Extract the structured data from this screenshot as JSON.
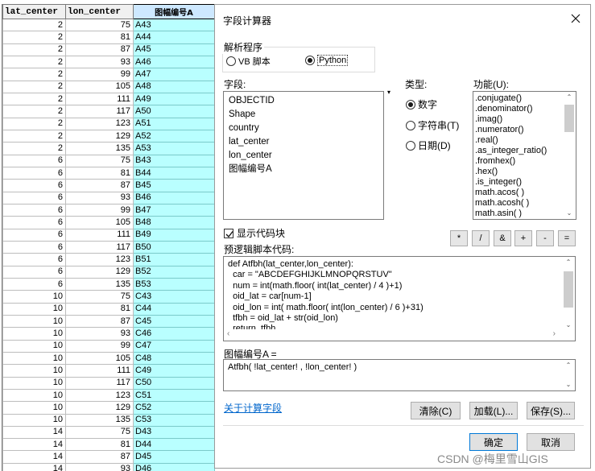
{
  "attribute_table": {
    "columns": [
      "lat_center",
      "lon_center",
      "图幅编号A"
    ],
    "rows": [
      [
        "2",
        "75",
        "A43"
      ],
      [
        "2",
        "81",
        "A44"
      ],
      [
        "2",
        "87",
        "A45"
      ],
      [
        "2",
        "93",
        "A46"
      ],
      [
        "2",
        "99",
        "A47"
      ],
      [
        "2",
        "105",
        "A48"
      ],
      [
        "2",
        "111",
        "A49"
      ],
      [
        "2",
        "117",
        "A50"
      ],
      [
        "2",
        "123",
        "A51"
      ],
      [
        "2",
        "129",
        "A52"
      ],
      [
        "2",
        "135",
        "A53"
      ],
      [
        "6",
        "75",
        "B43"
      ],
      [
        "6",
        "81",
        "B44"
      ],
      [
        "6",
        "87",
        "B45"
      ],
      [
        "6",
        "93",
        "B46"
      ],
      [
        "6",
        "99",
        "B47"
      ],
      [
        "6",
        "105",
        "B48"
      ],
      [
        "6",
        "111",
        "B49"
      ],
      [
        "6",
        "117",
        "B50"
      ],
      [
        "6",
        "123",
        "B51"
      ],
      [
        "6",
        "129",
        "B52"
      ],
      [
        "6",
        "135",
        "B53"
      ],
      [
        "10",
        "75",
        "C43"
      ],
      [
        "10",
        "81",
        "C44"
      ],
      [
        "10",
        "87",
        "C45"
      ],
      [
        "10",
        "93",
        "C46"
      ],
      [
        "10",
        "99",
        "C47"
      ],
      [
        "10",
        "105",
        "C48"
      ],
      [
        "10",
        "111",
        "C49"
      ],
      [
        "10",
        "117",
        "C50"
      ],
      [
        "10",
        "123",
        "C51"
      ],
      [
        "10",
        "129",
        "C52"
      ],
      [
        "10",
        "135",
        "C53"
      ],
      [
        "14",
        "75",
        "D43"
      ],
      [
        "14",
        "81",
        "D44"
      ],
      [
        "14",
        "87",
        "D45"
      ],
      [
        "14",
        "93",
        "D46"
      ]
    ]
  },
  "dialog": {
    "title": "字段计算器",
    "parser": {
      "legend": "解析程序",
      "options": [
        "VB 脚本",
        "Python"
      ],
      "selected": "Python"
    },
    "fields": {
      "label": "字段:",
      "items": [
        "OBJECTID",
        "Shape",
        "country",
        "lat_center",
        "lon_center",
        "图幅编号A"
      ]
    },
    "type": {
      "label": "类型:",
      "options": [
        "数字",
        "字符串(T)",
        "日期(D)"
      ],
      "selected": "数字"
    },
    "functions": {
      "label": "功能(U):",
      "items": [
        ".conjugate()",
        ".denominator()",
        ".imag()",
        ".numerator()",
        ".real()",
        ".as_integer_ratio()",
        ".fromhex()",
        ".hex()",
        ".is_integer()",
        "math.acos( )",
        "math.acosh( )",
        "math.asin( )"
      ]
    },
    "operators": [
      "*",
      "/",
      "&",
      "+",
      "-",
      "="
    ],
    "show_codeblock": {
      "label": "显示代码块",
      "checked": true
    },
    "codeblock": {
      "label": "预逻辑脚本代码:",
      "lines": [
        "def Atfbh(lat_center,lon_center):",
        "  car = \"ABCDEFGHIJKLMNOPQRSTUV\"",
        "  num = int(math.floor( int(lat_center) / 4 )+1)",
        "  oid_lat = car[num-1]",
        "  oid_lon = int( math.floor( int(lon_center) / 6 )+31)",
        "  tfbh = oid_lat + str(oid_lon)",
        "  return  tfbh"
      ]
    },
    "expression": {
      "label": "图幅编号A =",
      "value": "Atfbh( !lat_center! , !lon_center! )"
    },
    "about_link": "关于计算字段",
    "buttons": {
      "clear": "清除(C)",
      "load": "加载(L)...",
      "save": "保存(S)...",
      "ok": "确定",
      "cancel": "取消"
    }
  },
  "watermark": "CSDN @梅里雪山GIS"
}
